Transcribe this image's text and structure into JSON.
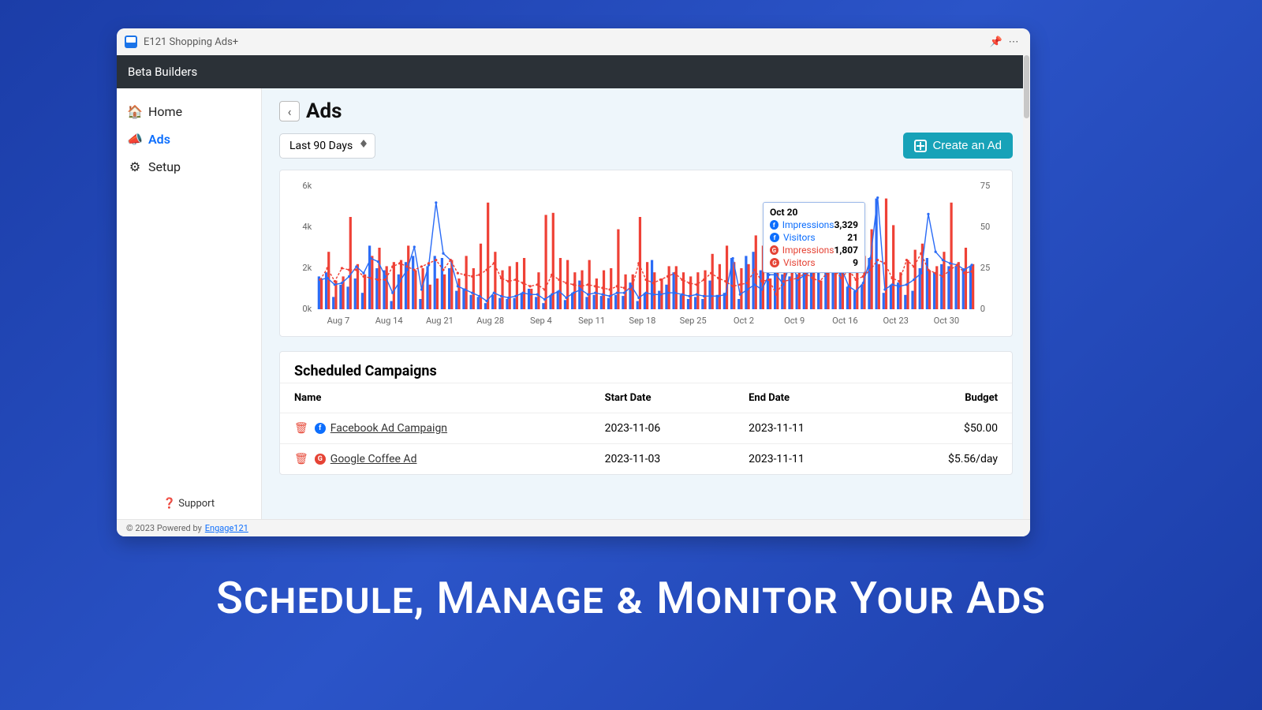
{
  "window": {
    "title": "E121 Shopping Ads+"
  },
  "topbar": {
    "brand": "Beta Builders"
  },
  "sidebar": {
    "items": [
      {
        "label": "Home",
        "icon": "home-icon"
      },
      {
        "label": "Ads",
        "icon": "megaphone-icon"
      },
      {
        "label": "Setup",
        "icon": "gear-icon"
      }
    ],
    "support_label": "Support"
  },
  "footer": {
    "copyright": "© 2023 Powered by",
    "link_label": "Engage121"
  },
  "page": {
    "title": "Ads",
    "range_selected": "Last 90 Days",
    "create_button": "Create an Ad"
  },
  "chart_data": {
    "type": "bar",
    "title": "",
    "xlabel": "",
    "ylabel_left": "",
    "ylabel_right": "",
    "ylim_left": [
      0,
      6000
    ],
    "ylim_right": [
      0,
      75
    ],
    "left_ticks": [
      "0k",
      "2k",
      "4k",
      "6k"
    ],
    "right_ticks": [
      0,
      25,
      50,
      75
    ],
    "categories": [
      "Aug 7",
      "Aug 14",
      "Aug 21",
      "Aug 28",
      "Sep 4",
      "Sep 11",
      "Sep 18",
      "Sep 25",
      "Oct 2",
      "Oct 9",
      "Oct 16",
      "Oct 23",
      "Oct 30"
    ],
    "series": [
      {
        "name": "Facebook Impressions",
        "kind": "bar",
        "color": "#2b6cf6",
        "axis": "left",
        "daily_values": [
          1600,
          1800,
          600,
          1200,
          1100,
          1500,
          800,
          3100,
          2000,
          1900,
          400,
          1700,
          2300,
          2600,
          500,
          2100,
          2600,
          2500,
          2000,
          900,
          1000,
          700,
          600,
          300,
          700,
          550,
          500,
          550,
          800,
          1000,
          600,
          300,
          700,
          900,
          450,
          800,
          1400,
          600,
          700,
          650,
          550,
          700,
          650,
          1300,
          400,
          800,
          2400,
          900,
          1200,
          1800,
          700,
          500,
          600,
          500,
          1400,
          700,
          800,
          2500,
          500,
          2600,
          2800,
          1900,
          3200,
          3300,
          1700,
          1600,
          1700,
          1900,
          2100,
          2300,
          2900,
          3100,
          2300,
          1100,
          900,
          1200,
          2500,
          5400,
          800,
          1200,
          1300,
          700,
          900,
          2000,
          2500,
          1800,
          2200,
          2100,
          2100,
          2000,
          2100
        ]
      },
      {
        "name": "Facebook Visitors",
        "kind": "line",
        "color": "#2b6cf6",
        "axis": "right",
        "daily_values": [
          18,
          19,
          15,
          16,
          20,
          26,
          22,
          31,
          29,
          20,
          10,
          17,
          24,
          38,
          12,
          27,
          65,
          34,
          30,
          14,
          12,
          10,
          8,
          5,
          10,
          8,
          7,
          8,
          10,
          9,
          9,
          6,
          9,
          11,
          7,
          10,
          12,
          9,
          10,
          9,
          8,
          10,
          10,
          14,
          7,
          10,
          9,
          9,
          10,
          10,
          9,
          8,
          9,
          8,
          8,
          8,
          9,
          31,
          9,
          12,
          15,
          12,
          21,
          21,
          15,
          30,
          18,
          21,
          24,
          27,
          31,
          34,
          25,
          14,
          11,
          16,
          31,
          68,
          12,
          15,
          14,
          15,
          18,
          22,
          58,
          35,
          30,
          28,
          27,
          24,
          27
        ]
      },
      {
        "name": "Google Impressions",
        "kind": "bar",
        "color": "#ef4136",
        "axis": "left",
        "daily_values": [
          1500,
          2800,
          1400,
          1600,
          4500,
          2200,
          1700,
          2600,
          3000,
          2100,
          2300,
          2400,
          3100,
          1900,
          2000,
          1200,
          1500,
          1700,
          2400,
          1500,
          2600,
          2000,
          3200,
          5200,
          2800,
          1900,
          2100,
          2300,
          2500,
          1000,
          1800,
          4600,
          4700,
          2500,
          2400,
          1800,
          1900,
          2400,
          1500,
          1900,
          2000,
          3900,
          1700,
          1700,
          4500,
          2300,
          1800,
          1500,
          2100,
          2100,
          1800,
          1600,
          1800,
          1900,
          2700,
          2200,
          3100,
          2300,
          2000,
          2200,
          3600,
          3100,
          1500,
          1800,
          2200,
          3000,
          3700,
          2000,
          2700,
          1400,
          2200,
          4000,
          2300,
          2900,
          1800,
          2600,
          3900,
          2200,
          5400,
          4100,
          1800,
          2400,
          2900,
          3200,
          1900,
          2100,
          2800,
          5200,
          2300,
          3000,
          2200
        ]
      },
      {
        "name": "Google Visitors",
        "kind": "line",
        "color": "#ef4136",
        "axis": "right",
        "daily_values": [
          18,
          25,
          17,
          25,
          24,
          24,
          20,
          19,
          18,
          18,
          26,
          28,
          26,
          24,
          26,
          28,
          30,
          24,
          30,
          22,
          21,
          20,
          21,
          24,
          28,
          19,
          17,
          18,
          16,
          14,
          15,
          12,
          21,
          18,
          16,
          15,
          14,
          15,
          14,
          13,
          12,
          14,
          13,
          12,
          28,
          18,
          16,
          18,
          20,
          22,
          18,
          16,
          15,
          18,
          22,
          19,
          17,
          14,
          15,
          16,
          24,
          17,
          18,
          9,
          17,
          18,
          19,
          22,
          19,
          17,
          22,
          24,
          19,
          24,
          18,
          20,
          24,
          30,
          28,
          19,
          17,
          30,
          26,
          34,
          24,
          22,
          20,
          24,
          27,
          22,
          23
        ]
      }
    ],
    "tooltip": {
      "date": "Oct 20",
      "rows": [
        {
          "brand": "fb",
          "label": "Impressions",
          "value": "3,329"
        },
        {
          "brand": "fb",
          "label": "Visitors",
          "value": "21"
        },
        {
          "brand": "gg",
          "label": "Impressions",
          "value": "1,807"
        },
        {
          "brand": "gg",
          "label": "Visitors",
          "value": "9"
        }
      ]
    }
  },
  "campaigns": {
    "title": "Scheduled Campaigns",
    "columns": [
      "Name",
      "Start Date",
      "End Date",
      "Budget"
    ],
    "rows": [
      {
        "brand": "fb",
        "name": "Facebook Ad Campaign",
        "start": "2023-11-06",
        "end": "2023-11-11",
        "budget": "$50.00"
      },
      {
        "brand": "gg",
        "name": "Google Coffee Ad",
        "start": "2023-11-03",
        "end": "2023-11-11",
        "budget": "$5.56/day"
      }
    ]
  },
  "tagline": "Schedule, Manage & Monitor Your Ads"
}
